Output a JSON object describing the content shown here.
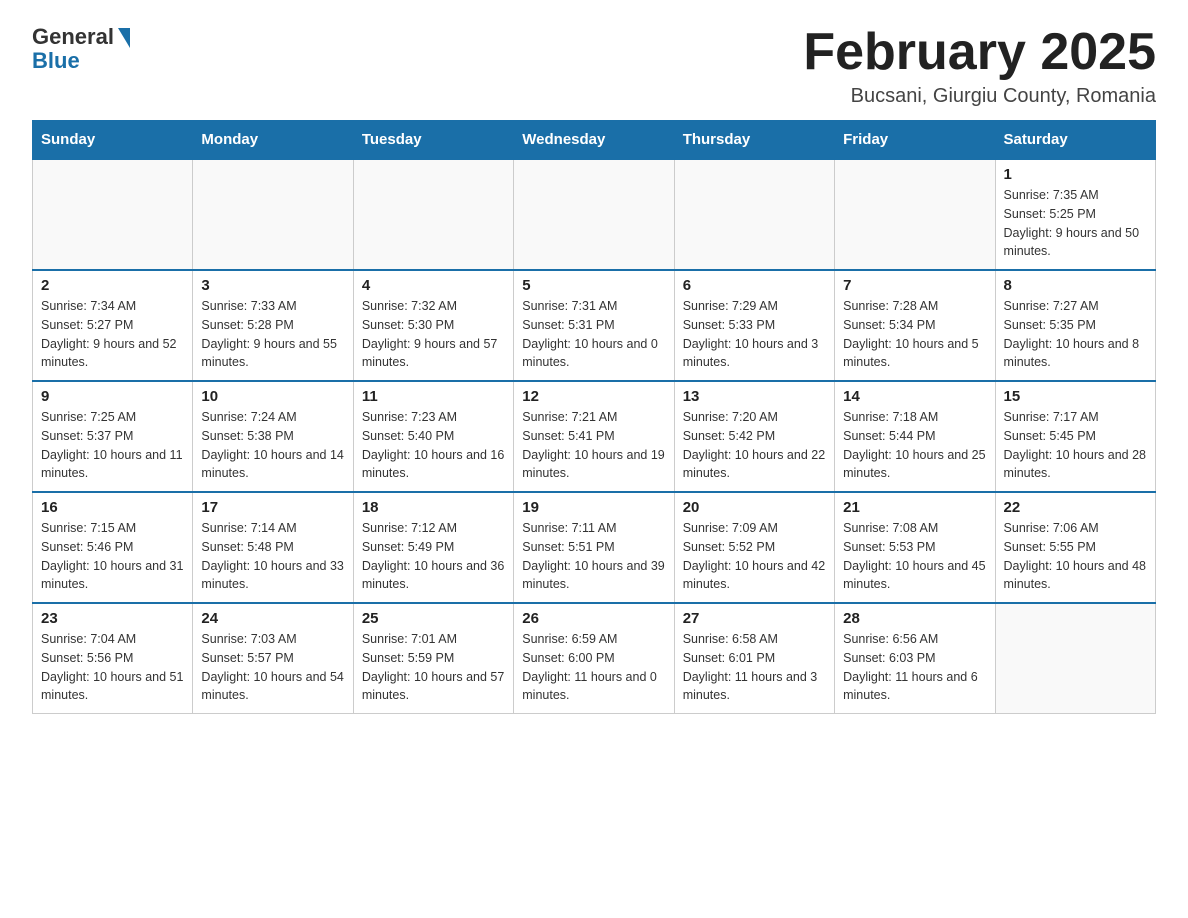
{
  "header": {
    "logo_general": "General",
    "logo_blue": "Blue",
    "month_title": "February 2025",
    "location": "Bucsani, Giurgiu County, Romania"
  },
  "days_of_week": [
    "Sunday",
    "Monday",
    "Tuesday",
    "Wednesday",
    "Thursday",
    "Friday",
    "Saturday"
  ],
  "weeks": [
    [
      {
        "day": "",
        "info": ""
      },
      {
        "day": "",
        "info": ""
      },
      {
        "day": "",
        "info": ""
      },
      {
        "day": "",
        "info": ""
      },
      {
        "day": "",
        "info": ""
      },
      {
        "day": "",
        "info": ""
      },
      {
        "day": "1",
        "info": "Sunrise: 7:35 AM\nSunset: 5:25 PM\nDaylight: 9 hours and 50 minutes."
      }
    ],
    [
      {
        "day": "2",
        "info": "Sunrise: 7:34 AM\nSunset: 5:27 PM\nDaylight: 9 hours and 52 minutes."
      },
      {
        "day": "3",
        "info": "Sunrise: 7:33 AM\nSunset: 5:28 PM\nDaylight: 9 hours and 55 minutes."
      },
      {
        "day": "4",
        "info": "Sunrise: 7:32 AM\nSunset: 5:30 PM\nDaylight: 9 hours and 57 minutes."
      },
      {
        "day": "5",
        "info": "Sunrise: 7:31 AM\nSunset: 5:31 PM\nDaylight: 10 hours and 0 minutes."
      },
      {
        "day": "6",
        "info": "Sunrise: 7:29 AM\nSunset: 5:33 PM\nDaylight: 10 hours and 3 minutes."
      },
      {
        "day": "7",
        "info": "Sunrise: 7:28 AM\nSunset: 5:34 PM\nDaylight: 10 hours and 5 minutes."
      },
      {
        "day": "8",
        "info": "Sunrise: 7:27 AM\nSunset: 5:35 PM\nDaylight: 10 hours and 8 minutes."
      }
    ],
    [
      {
        "day": "9",
        "info": "Sunrise: 7:25 AM\nSunset: 5:37 PM\nDaylight: 10 hours and 11 minutes."
      },
      {
        "day": "10",
        "info": "Sunrise: 7:24 AM\nSunset: 5:38 PM\nDaylight: 10 hours and 14 minutes."
      },
      {
        "day": "11",
        "info": "Sunrise: 7:23 AM\nSunset: 5:40 PM\nDaylight: 10 hours and 16 minutes."
      },
      {
        "day": "12",
        "info": "Sunrise: 7:21 AM\nSunset: 5:41 PM\nDaylight: 10 hours and 19 minutes."
      },
      {
        "day": "13",
        "info": "Sunrise: 7:20 AM\nSunset: 5:42 PM\nDaylight: 10 hours and 22 minutes."
      },
      {
        "day": "14",
        "info": "Sunrise: 7:18 AM\nSunset: 5:44 PM\nDaylight: 10 hours and 25 minutes."
      },
      {
        "day": "15",
        "info": "Sunrise: 7:17 AM\nSunset: 5:45 PM\nDaylight: 10 hours and 28 minutes."
      }
    ],
    [
      {
        "day": "16",
        "info": "Sunrise: 7:15 AM\nSunset: 5:46 PM\nDaylight: 10 hours and 31 minutes."
      },
      {
        "day": "17",
        "info": "Sunrise: 7:14 AM\nSunset: 5:48 PM\nDaylight: 10 hours and 33 minutes."
      },
      {
        "day": "18",
        "info": "Sunrise: 7:12 AM\nSunset: 5:49 PM\nDaylight: 10 hours and 36 minutes."
      },
      {
        "day": "19",
        "info": "Sunrise: 7:11 AM\nSunset: 5:51 PM\nDaylight: 10 hours and 39 minutes."
      },
      {
        "day": "20",
        "info": "Sunrise: 7:09 AM\nSunset: 5:52 PM\nDaylight: 10 hours and 42 minutes."
      },
      {
        "day": "21",
        "info": "Sunrise: 7:08 AM\nSunset: 5:53 PM\nDaylight: 10 hours and 45 minutes."
      },
      {
        "day": "22",
        "info": "Sunrise: 7:06 AM\nSunset: 5:55 PM\nDaylight: 10 hours and 48 minutes."
      }
    ],
    [
      {
        "day": "23",
        "info": "Sunrise: 7:04 AM\nSunset: 5:56 PM\nDaylight: 10 hours and 51 minutes."
      },
      {
        "day": "24",
        "info": "Sunrise: 7:03 AM\nSunset: 5:57 PM\nDaylight: 10 hours and 54 minutes."
      },
      {
        "day": "25",
        "info": "Sunrise: 7:01 AM\nSunset: 5:59 PM\nDaylight: 10 hours and 57 minutes."
      },
      {
        "day": "26",
        "info": "Sunrise: 6:59 AM\nSunset: 6:00 PM\nDaylight: 11 hours and 0 minutes."
      },
      {
        "day": "27",
        "info": "Sunrise: 6:58 AM\nSunset: 6:01 PM\nDaylight: 11 hours and 3 minutes."
      },
      {
        "day": "28",
        "info": "Sunrise: 6:56 AM\nSunset: 6:03 PM\nDaylight: 11 hours and 6 minutes."
      },
      {
        "day": "",
        "info": ""
      }
    ]
  ]
}
